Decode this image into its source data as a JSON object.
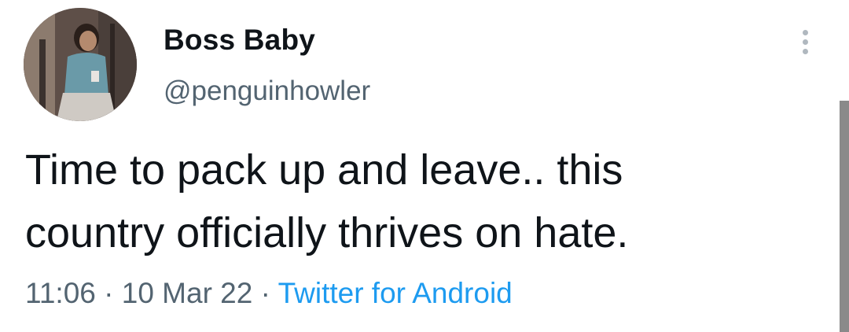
{
  "tweet": {
    "display_name": "Boss Baby",
    "handle": "@penguinhowler",
    "text": "Time to pack up and leave.. this\ncountry officially thrives on hate.",
    "time": "11:06",
    "separator": " · ",
    "date": "10 Mar 22",
    "source": "Twitter for Android"
  },
  "icons": {
    "avatar": "profile-photo",
    "more": "vertical-ellipsis-icon"
  },
  "colors": {
    "text": "#0f1419",
    "secondary": "#536471",
    "link": "#1d9bf0",
    "scrollbar": "#8a8a8a"
  }
}
